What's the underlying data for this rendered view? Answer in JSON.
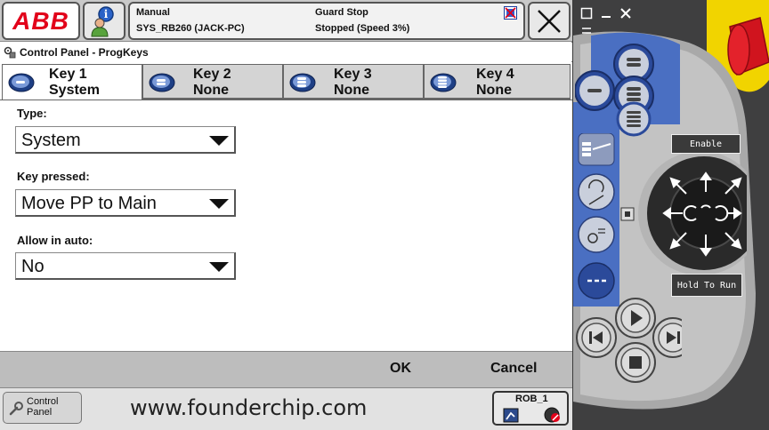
{
  "header": {
    "logo_text": "ABB",
    "mode": "Manual",
    "system": "SYS_RB260 (JACK-PC)",
    "guard_status": "Guard Stop",
    "run_status": "Stopped (Speed 3%)"
  },
  "window": {
    "title": "Control Panel - ProgKeys"
  },
  "tabs": [
    {
      "line1": "Key 1",
      "line2": "System",
      "active": true
    },
    {
      "line1": "Key 2",
      "line2": "None",
      "active": false
    },
    {
      "line1": "Key 3",
      "line2": "None",
      "active": false
    },
    {
      "line1": "Key 4",
      "line2": "None",
      "active": false
    }
  ],
  "form": {
    "type_label": "Type:",
    "type_value": "System",
    "key_pressed_label": "Key pressed:",
    "key_pressed_value": "Move PP to Main",
    "allow_auto_label": "Allow in auto:",
    "allow_auto_value": "No"
  },
  "commands": {
    "ok": "OK",
    "cancel": "Cancel"
  },
  "taskbar": {
    "control_panel_line1": "Control",
    "control_panel_line2": "Panel",
    "watermark": "www.founderchip.com",
    "robot_label": "ROB_1"
  },
  "device": {
    "enable_label": "Enable",
    "hold_to_run_label": "Hold To Run"
  },
  "colors": {
    "abb_red": "#e2001a",
    "device_blue": "#4a6fc2",
    "emergency_red": "#d0141e",
    "tab_bg": "#d4d4d4"
  }
}
